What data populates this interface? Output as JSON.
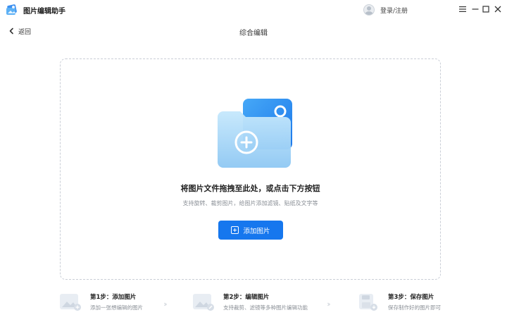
{
  "app": {
    "title": "图片编辑助手",
    "login_label": "登录/注册"
  },
  "window_controls": [
    "menu",
    "minimize",
    "maximize",
    "close"
  ],
  "nav": {
    "back_label": "返回",
    "page_title": "综合编辑"
  },
  "dropzone": {
    "title": "将图片文件拖拽至此处，或点击下方按钮",
    "subtitle": "支持旋转、裁剪图片，给图片添加滤镜、贴纸及文字等",
    "button_label": "添加图片"
  },
  "steps": [
    {
      "title": "第1步：添加图片",
      "desc": "添加一张想编辑的图片"
    },
    {
      "title": "第2步：编辑图片",
      "desc": "支持裁剪、滤镜等多种图片编辑功能"
    },
    {
      "title": "第3步：保存图片",
      "desc": "保存制作好的图片即可"
    }
  ],
  "colors": {
    "accent": "#1677ee",
    "folder_back": "#2f8ff0",
    "folder_front": "#9fd3f7"
  }
}
